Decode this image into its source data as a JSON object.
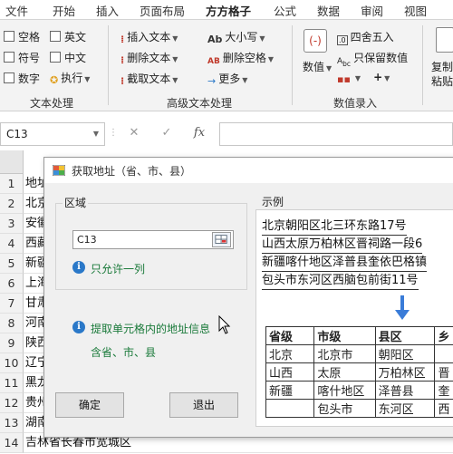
{
  "tabs": [
    "文件",
    "开始",
    "插入",
    "页面布局",
    "方方格子",
    "公式",
    "数据",
    "审阅",
    "视图"
  ],
  "active_tab": "方方格子",
  "text_group": {
    "checks": [
      "空格",
      "英文",
      "符号",
      "中文",
      "数字"
    ],
    "exec_label": "执行",
    "label": "文本处理"
  },
  "adv_text_group": {
    "items": [
      "插入文本",
      "删除文本",
      "截取文本"
    ],
    "items2": [
      "大小写",
      "删除空格",
      "更多"
    ],
    "label": "高级文本处理"
  },
  "numeric_group": {
    "value_label": "数值",
    "items": [
      "四舍五入",
      "只保留数值"
    ],
    "label": "数值录入"
  },
  "copy_label": "复制",
  "copy_label2": "粘贴",
  "namebox": "C13",
  "fx": "fx",
  "rows": [
    "1",
    "2",
    "3",
    "4",
    "5",
    "6",
    "7",
    "8",
    "9",
    "10",
    "11",
    "12",
    "13",
    "14"
  ],
  "sheet_cells": [
    "地址",
    "北京",
    "安徽",
    "西藏",
    "新疆",
    "上海",
    "甘肃",
    "河南",
    "陕西",
    "辽宁",
    "黑龙",
    "贵州",
    "湖南",
    "吉林省长春市宽城区"
  ],
  "dialog": {
    "title": "获取地址（省、市、县）",
    "region_label": "区域",
    "range_value": "C13",
    "hint1": "只允许一列",
    "hint2": "提取单元格内的地址信息",
    "hint3": "含省、市、县",
    "ok": "确定",
    "cancel": "退出",
    "example_label": "示例",
    "examples": [
      "北京朝阳区北三环东路17号",
      "山西太原万柏林区晋祠路一段6",
      "新疆喀什地区泽普县奎依巴格镇",
      "包头市东河区西脑包前街11号"
    ],
    "table_header": [
      "省级",
      "市级",
      "县区",
      "乡"
    ],
    "table_rows": [
      [
        "北京",
        "北京市",
        "朝阳区",
        ""
      ],
      [
        "山西",
        "太原",
        "万柏林区",
        "晋"
      ],
      [
        "新疆",
        "喀什地区",
        "泽普县",
        "奎"
      ],
      [
        "",
        "包头市",
        "东河区",
        "西"
      ]
    ]
  },
  "colors": {
    "accent": "#217346",
    "info": "#2a78c8",
    "hint_green": "#1a7a3a",
    "arrow": "#3a7cd8"
  }
}
